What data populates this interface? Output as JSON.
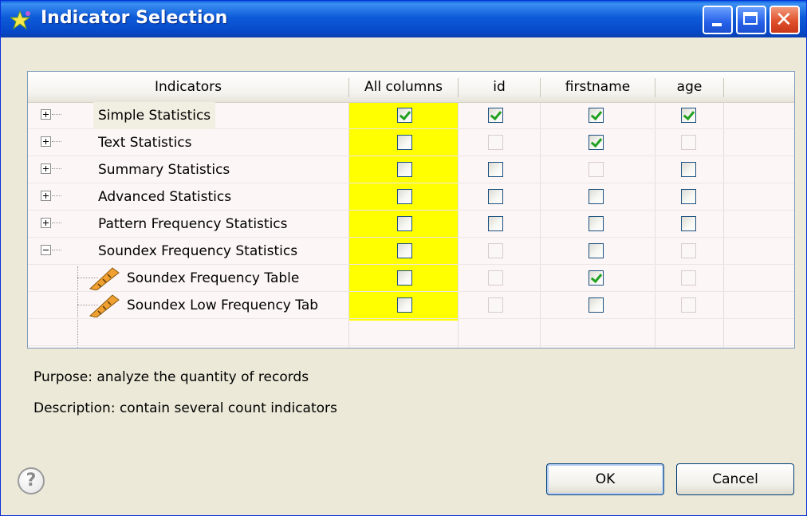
{
  "window": {
    "title": "Indicator Selection",
    "title_icon": "indicator-star-icon"
  },
  "table": {
    "headers": [
      "Indicators",
      "All columns",
      "id",
      "firstname",
      "age"
    ],
    "rows": [
      {
        "label": "Simple Statistics",
        "expander": "plus",
        "checks": [
          "on",
          "on",
          "on",
          "on"
        ]
      },
      {
        "label": "Text Statistics",
        "expander": "plus",
        "checks": [
          "off",
          "dis",
          "on",
          "dis"
        ]
      },
      {
        "label": "Summary Statistics",
        "expander": "plus",
        "checks": [
          "off",
          "off",
          "dis",
          "off"
        ]
      },
      {
        "label": "Advanced Statistics",
        "expander": "plus",
        "checks": [
          "off",
          "off",
          "off",
          "off"
        ]
      },
      {
        "label": "Pattern Frequency Statistics",
        "expander": "plus",
        "checks": [
          "off",
          "off",
          "off",
          "off"
        ]
      },
      {
        "label": "Soundex Frequency Statistics",
        "expander": "minus",
        "checks": [
          "off",
          "dis",
          "off",
          "dis"
        ]
      },
      {
        "label": "Soundex Frequency Table",
        "child": true,
        "icon": "ruler-icon",
        "checks": [
          "off",
          "dis",
          "on",
          "dis"
        ]
      },
      {
        "label": "Soundex Low Frequency Tab",
        "child": true,
        "icon": "ruler-icon",
        "checks": [
          "off",
          "dis",
          "off",
          "dis"
        ]
      }
    ]
  },
  "info": {
    "purpose": "Purpose: analyze the quantity of records",
    "description": "Description: contain several count indicators"
  },
  "buttons": {
    "ok": "OK",
    "cancel": "Cancel"
  },
  "colors": {
    "highlight_column": "#ffff00",
    "check": "#21a121",
    "title_bar": "#0a5fe0"
  }
}
